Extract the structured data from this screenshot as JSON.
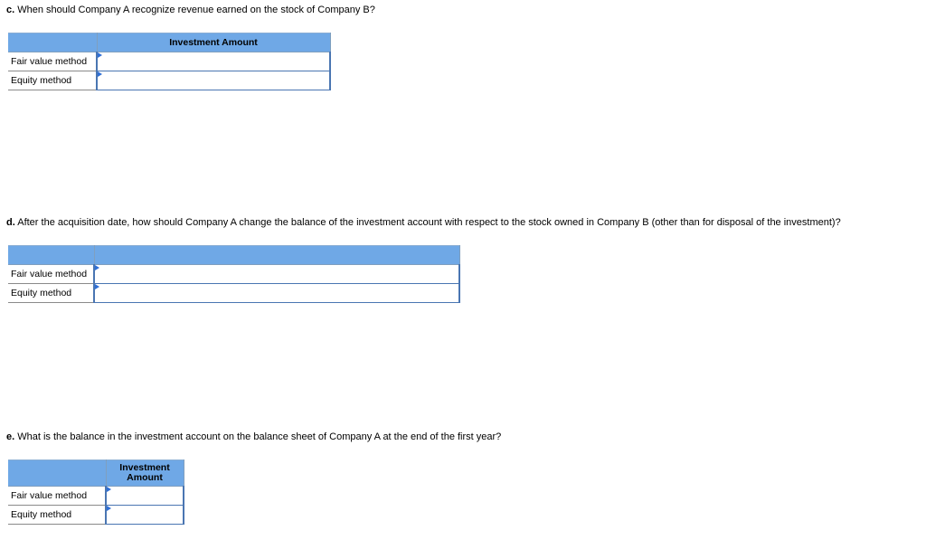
{
  "questions": [
    {
      "id": "c",
      "letter": "c.",
      "text": " When should Company A recognize revenue earned on the stock of Company B?",
      "table": {
        "header": [
          "",
          "Investment Amount"
        ],
        "rows": [
          {
            "label": "Fair value method",
            "value": ""
          },
          {
            "label": "Equity method",
            "value": ""
          }
        ]
      }
    },
    {
      "id": "d",
      "letter": "d.",
      "text": " After the acquisition date, how should Company A change the balance of the investment account with respect to the stock owned in Company B (other than for disposal of the investment)?",
      "table": {
        "header": [
          "",
          ""
        ],
        "rows": [
          {
            "label": "Fair value method",
            "value": ""
          },
          {
            "label": "Equity method",
            "value": ""
          }
        ]
      }
    },
    {
      "id": "e",
      "letter": "e.",
      "text": " What is the balance in the investment account on the balance sheet of Company A at the end of the first year?",
      "table": {
        "header": [
          "",
          "Investment Amount"
        ],
        "header_lines": [
          "Investment",
          "Amount"
        ],
        "rows": [
          {
            "label": "Fair value method",
            "value": ""
          },
          {
            "label": "Equity method",
            "value": ""
          }
        ]
      }
    }
  ],
  "colors": {
    "header_bg": "#6fa8e6",
    "input_border": "#4a76b2",
    "entry_flag": "#2f6fd6"
  }
}
